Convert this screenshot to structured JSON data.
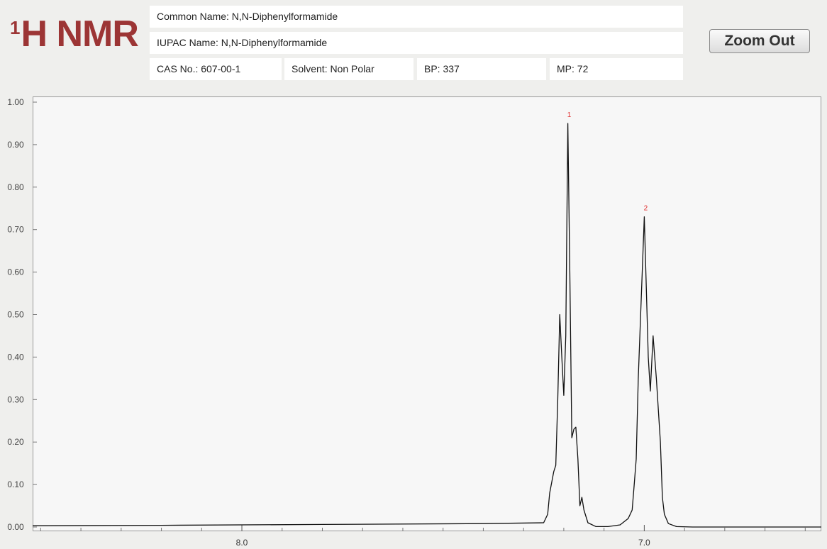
{
  "header": {
    "logo_sup": "1",
    "logo_text": "H NMR",
    "common_name": "Common Name:  N,N-Diphenylformamide",
    "iupac_name": "IUPAC Name:  N,N-Diphenylformamide",
    "cas_no": "CAS No.: 607-00-1",
    "solvent": "Solvent: Non Polar",
    "bp": "BP: 337",
    "mp": "MP: 72",
    "zoom_out_label": "Zoom Out"
  },
  "colors": {
    "logo": "#9c3535",
    "trace": "#111111",
    "peak_label": "#e03030"
  },
  "chart_data": {
    "type": "line",
    "title": "",
    "xlabel": "",
    "ylabel": "",
    "x_reversed": true,
    "xlim": [
      8.52,
      6.56
    ],
    "ylim": [
      0,
      1.0
    ],
    "grid": false,
    "y_ticks": [
      "0.00",
      "0.10",
      "0.20",
      "0.30",
      "0.40",
      "0.50",
      "0.60",
      "0.70",
      "0.80",
      "0.90",
      "1.00"
    ],
    "x_tick_labels": [
      {
        "value": 8.0,
        "label": "8.0"
      },
      {
        "value": 7.0,
        "label": "7.0"
      }
    ],
    "x_minor_ticks": [
      8.5,
      8.4,
      8.3,
      8.2,
      8.1,
      7.9,
      7.8,
      7.7,
      7.6,
      7.5,
      7.4,
      7.3,
      7.2,
      7.1,
      6.9,
      6.8,
      6.7,
      6.6
    ],
    "series": [
      {
        "x": [
          8.52,
          8.2,
          7.8,
          7.4,
          7.25,
          7.24,
          7.235,
          7.225,
          7.22,
          7.215,
          7.21,
          7.205,
          7.2,
          7.195,
          7.19,
          7.185,
          7.18,
          7.175,
          7.17,
          7.165,
          7.16,
          7.155,
          7.15,
          7.14,
          7.12,
          7.09,
          7.06,
          7.04,
          7.03,
          7.025,
          7.02,
          7.015,
          7.0,
          6.99,
          6.985,
          6.978,
          6.97,
          6.96,
          6.955,
          6.95,
          6.94,
          6.92,
          6.88,
          6.8,
          6.7,
          6.56
        ],
        "y": [
          0.003,
          0.004,
          0.006,
          0.008,
          0.01,
          0.03,
          0.08,
          0.13,
          0.145,
          0.3,
          0.5,
          0.4,
          0.31,
          0.45,
          0.95,
          0.6,
          0.21,
          0.23,
          0.235,
          0.16,
          0.05,
          0.07,
          0.04,
          0.01,
          0.001,
          0.001,
          0.005,
          0.02,
          0.04,
          0.1,
          0.16,
          0.35,
          0.73,
          0.4,
          0.32,
          0.45,
          0.35,
          0.2,
          0.07,
          0.03,
          0.008,
          0.001,
          0.0,
          0.0,
          0.0,
          0.0
        ]
      }
    ],
    "peak_labels": [
      {
        "label": "1",
        "x": 7.19,
        "y": 0.95
      },
      {
        "label": "2",
        "x": 7.0,
        "y": 0.73
      }
    ]
  }
}
